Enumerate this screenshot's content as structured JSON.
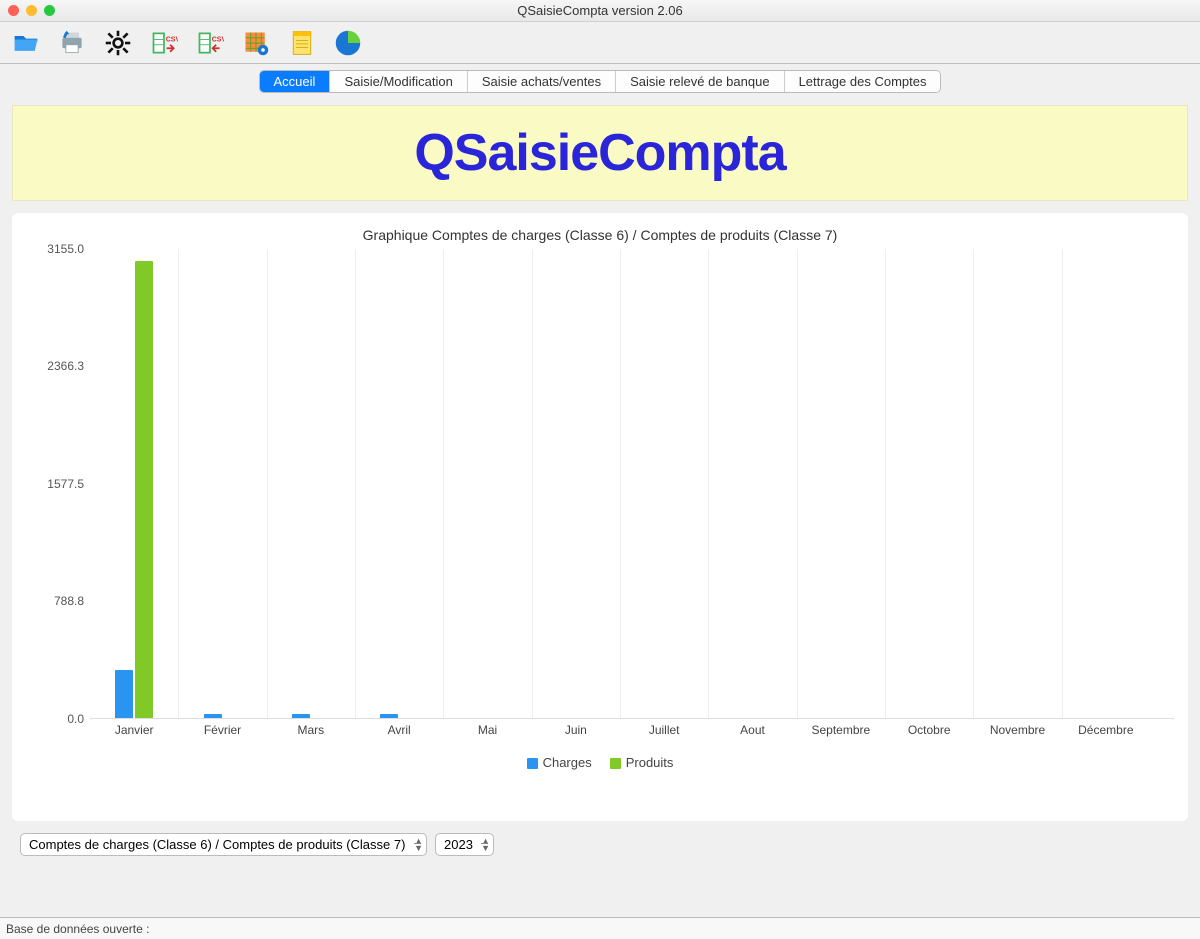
{
  "window": {
    "title": "QSaisieCompta version 2.06"
  },
  "tabs": [
    {
      "label": "Accueil",
      "active": true
    },
    {
      "label": "Saisie/Modification",
      "active": false
    },
    {
      "label": "Saisie achats/ventes",
      "active": false
    },
    {
      "label": "Saisie relevé de banque",
      "active": false
    },
    {
      "label": "Lettrage des Comptes",
      "active": false
    }
  ],
  "banner": {
    "title": "QSaisieCompta"
  },
  "chart_data": {
    "type": "bar",
    "title": "Graphique Comptes de charges (Classe 6) / Comptes de produits (Classe 7)",
    "categories": [
      "Janvier",
      "Février",
      "Mars",
      "Avril",
      "Mai",
      "Juin",
      "Juillet",
      "Aout",
      "Septembre",
      "Octobre",
      "Novembre",
      "Décembre"
    ],
    "series": [
      {
        "name": "Charges",
        "values": [
          320,
          25,
          25,
          25,
          0,
          0,
          0,
          0,
          0,
          0,
          0,
          0
        ]
      },
      {
        "name": "Produits",
        "values": [
          3070,
          0,
          0,
          0,
          0,
          0,
          0,
          0,
          0,
          0,
          0,
          0
        ]
      }
    ],
    "y_ticks": [
      0.0,
      788.8,
      1577.5,
      2366.3,
      3155.0
    ],
    "ylim": [
      0,
      3155.0
    ],
    "legend": [
      "Charges",
      "Produits"
    ]
  },
  "controls": {
    "chart_select": "Comptes de charges (Classe 6) / Comptes de produits (Classe 7)",
    "year": "2023"
  },
  "status": {
    "text": "Base de données ouverte :"
  }
}
